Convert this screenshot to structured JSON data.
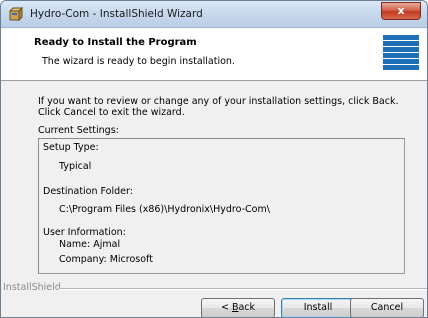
{
  "window": {
    "title": "Hydro-Com - InstallShield Wizard",
    "close_label": "x"
  },
  "header": {
    "title": "Ready to Install the Program",
    "subtitle": "The wizard is ready to begin installation."
  },
  "body": {
    "intro": "If you want to review or change any of your installation settings, click Back. Click Cancel to exit the wizard.",
    "current_settings_label": "Current Settings:",
    "setup_type_label": "Setup Type:",
    "setup_type_value": "Typical",
    "destination_label": "Destination Folder:",
    "destination_value": "C:\\Program Files (x86)\\Hydronix\\Hydro-Com\\",
    "user_info_label": "User Information:",
    "user_name": "Name: Ajmal",
    "user_company": "Company: Microsoft"
  },
  "footer": {
    "brand": "InstallShield",
    "back_prefix": "< ",
    "back_accel": "B",
    "back_rest": "ack",
    "install_label": "Install",
    "cancel_label": "Cancel"
  },
  "colors": {
    "logo_blue": "#1f6fb8",
    "close_red": "#c23a20"
  },
  "icons": {
    "title": "installer-box-icon",
    "header": "installshield-stripes-logo"
  }
}
